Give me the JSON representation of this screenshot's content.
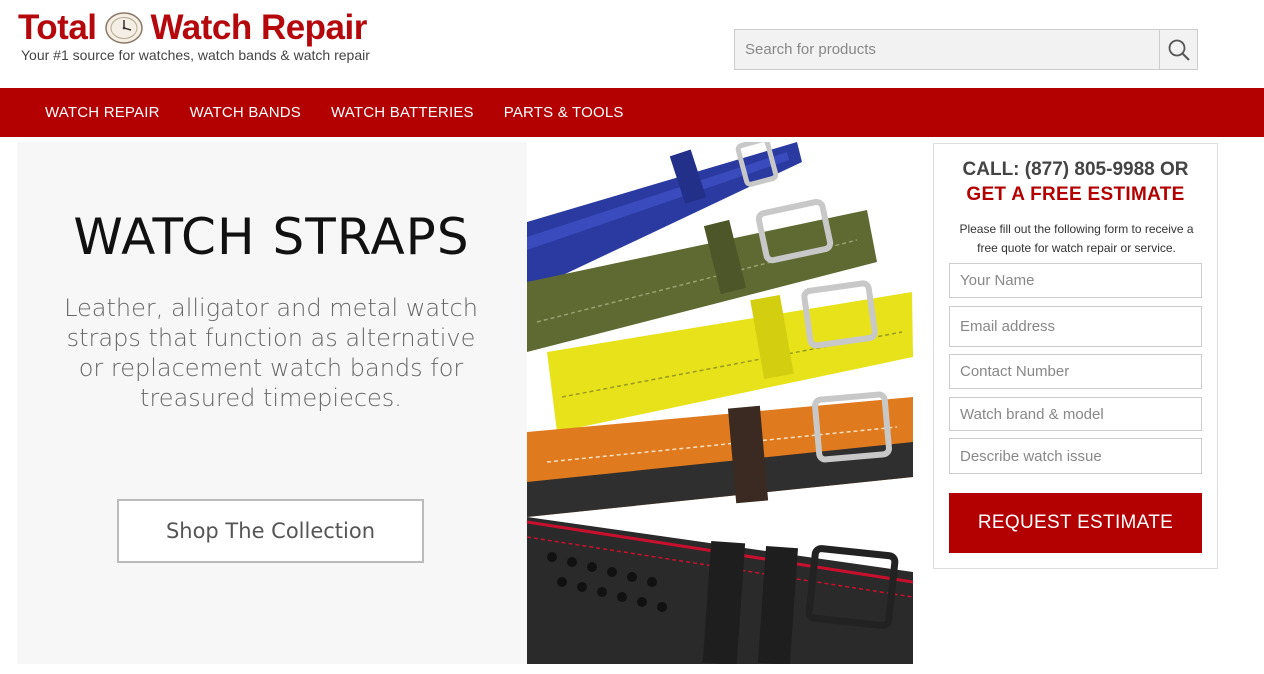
{
  "brand": {
    "logo_left": "Total",
    "logo_right": "Watch Repair",
    "tagline": "Your #1 source for watches, watch bands & watch repair",
    "accent_color": "#b30000"
  },
  "search": {
    "placeholder": "Search for products",
    "icon": "search-icon"
  },
  "nav": {
    "items": [
      {
        "label": "WATCH REPAIR"
      },
      {
        "label": "WATCH BANDS"
      },
      {
        "label": "WATCH BATTERIES"
      },
      {
        "label": "PARTS & TOOLS"
      }
    ]
  },
  "hero": {
    "title": "WATCH STRAPS",
    "subtitle": "Leather, alligator and metal watch straps that function as alternative or replacement watch bands for treasured timepieces.",
    "button_label": "Shop The Collection",
    "strap_colors": [
      "#2b3aa0",
      "#5e6a32",
      "#e8e21a",
      "#e07a1e",
      "#2a2a2a"
    ]
  },
  "estimate": {
    "call_line": "CALL: (877) 805-9988 OR",
    "free_line": "GET A FREE ESTIMATE",
    "note": "Please fill out the following form to receive a free quote for watch repair or service.",
    "fields": [
      {
        "placeholder": "Your Name"
      },
      {
        "placeholder": "Email address"
      },
      {
        "placeholder": "Contact Number"
      },
      {
        "placeholder": "Watch brand & model"
      },
      {
        "placeholder": "Describe watch issue"
      }
    ],
    "button_label": "REQUEST ESTIMATE"
  }
}
